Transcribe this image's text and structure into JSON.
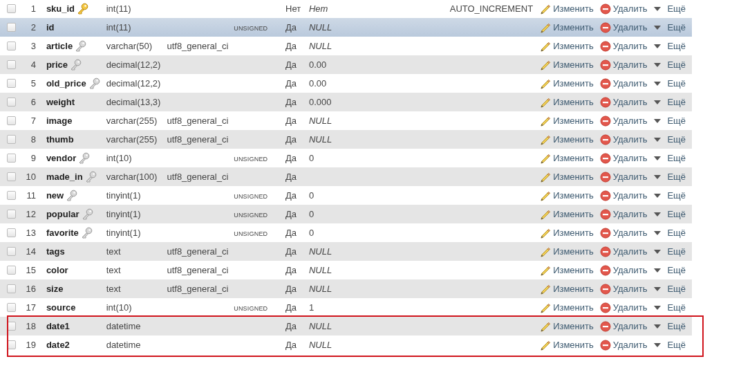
{
  "columns_table": {
    "rows": [
      {
        "checked": false,
        "hovered": false,
        "framed": false,
        "number": "1",
        "name": "sku_id",
        "key": {
          "kind": "primary"
        },
        "type": "int(11)",
        "null": "Нет",
        "default": "Нет",
        "default_italic": true,
        "extra": "AUTO_INCREMENT",
        "actions": [
          {
            "kind": "edit",
            "label": "Изменить"
          },
          {
            "kind": "drop",
            "label": "Удалить"
          },
          {
            "kind": "more",
            "label": "Ещё"
          }
        ]
      },
      {
        "checked": false,
        "hovered": true,
        "framed": false,
        "number": "2",
        "name": "id",
        "type": "int(11)",
        "attributes": "UNSIGNED",
        "null": "Да",
        "default": "NULL",
        "default_italic": true,
        "actions": [
          {
            "kind": "edit",
            "label": "Изменить"
          },
          {
            "kind": "drop",
            "label": "Удалить"
          },
          {
            "kind": "more",
            "label": "Ещё"
          }
        ]
      },
      {
        "checked": false,
        "hovered": false,
        "framed": false,
        "number": "3",
        "name": "article",
        "key": {
          "kind": "index"
        },
        "type": "varchar(50)",
        "collation": "utf8_general_ci",
        "null": "Да",
        "default": "NULL",
        "default_italic": true,
        "actions": [
          {
            "kind": "edit",
            "label": "Изменить"
          },
          {
            "kind": "drop",
            "label": "Удалить"
          },
          {
            "kind": "more",
            "label": "Ещё"
          }
        ]
      },
      {
        "checked": false,
        "hovered": false,
        "framed": false,
        "number": "4",
        "name": "price",
        "key": {
          "kind": "index"
        },
        "type": "decimal(12,2)",
        "null": "Да",
        "default": "0.00",
        "default_italic": false,
        "actions": [
          {
            "kind": "edit",
            "label": "Изменить"
          },
          {
            "kind": "drop",
            "label": "Удалить"
          },
          {
            "kind": "more",
            "label": "Ещё"
          }
        ]
      },
      {
        "checked": false,
        "hovered": false,
        "framed": false,
        "number": "5",
        "name": "old_price",
        "key": {
          "kind": "index"
        },
        "type": "decimal(12,2)",
        "null": "Да",
        "default": "0.00",
        "default_italic": false,
        "actions": [
          {
            "kind": "edit",
            "label": "Изменить"
          },
          {
            "kind": "drop",
            "label": "Удалить"
          },
          {
            "kind": "more",
            "label": "Ещё"
          }
        ]
      },
      {
        "checked": false,
        "hovered": false,
        "framed": false,
        "number": "6",
        "name": "weight",
        "type": "decimal(13,3)",
        "null": "Да",
        "default": "0.000",
        "default_italic": false,
        "actions": [
          {
            "kind": "edit",
            "label": "Изменить"
          },
          {
            "kind": "drop",
            "label": "Удалить"
          },
          {
            "kind": "more",
            "label": "Ещё"
          }
        ]
      },
      {
        "checked": false,
        "hovered": false,
        "framed": false,
        "number": "7",
        "name": "image",
        "type": "varchar(255)",
        "collation": "utf8_general_ci",
        "null": "Да",
        "default": "NULL",
        "default_italic": true,
        "actions": [
          {
            "kind": "edit",
            "label": "Изменить"
          },
          {
            "kind": "drop",
            "label": "Удалить"
          },
          {
            "kind": "more",
            "label": "Ещё"
          }
        ]
      },
      {
        "checked": false,
        "hovered": false,
        "framed": false,
        "number": "8",
        "name": "thumb",
        "type": "varchar(255)",
        "collation": "utf8_general_ci",
        "null": "Да",
        "default": "NULL",
        "default_italic": true,
        "actions": [
          {
            "kind": "edit",
            "label": "Изменить"
          },
          {
            "kind": "drop",
            "label": "Удалить"
          },
          {
            "kind": "more",
            "label": "Ещё"
          }
        ]
      },
      {
        "checked": false,
        "hovered": false,
        "framed": false,
        "number": "9",
        "name": "vendor",
        "key": {
          "kind": "index"
        },
        "type": "int(10)",
        "attributes": "UNSIGNED",
        "null": "Да",
        "default": "0",
        "default_italic": false,
        "actions": [
          {
            "kind": "edit",
            "label": "Изменить"
          },
          {
            "kind": "drop",
            "label": "Удалить"
          },
          {
            "kind": "more",
            "label": "Ещё"
          }
        ]
      },
      {
        "checked": false,
        "hovered": false,
        "framed": false,
        "number": "10",
        "name": "made_in",
        "key": {
          "kind": "index"
        },
        "type": "varchar(100)",
        "collation": "utf8_general_ci",
        "null": "Да",
        "actions": [
          {
            "kind": "edit",
            "label": "Изменить"
          },
          {
            "kind": "drop",
            "label": "Удалить"
          },
          {
            "kind": "more",
            "label": "Ещё"
          }
        ]
      },
      {
        "checked": false,
        "hovered": false,
        "framed": false,
        "number": "11",
        "name": "new",
        "key": {
          "kind": "index"
        },
        "type": "tinyint(1)",
        "attributes": "UNSIGNED",
        "null": "Да",
        "default": "0",
        "default_italic": false,
        "actions": [
          {
            "kind": "edit",
            "label": "Изменить"
          },
          {
            "kind": "drop",
            "label": "Удалить"
          },
          {
            "kind": "more",
            "label": "Ещё"
          }
        ]
      },
      {
        "checked": false,
        "hovered": false,
        "framed": false,
        "number": "12",
        "name": "popular",
        "key": {
          "kind": "index"
        },
        "type": "tinyint(1)",
        "attributes": "UNSIGNED",
        "null": "Да",
        "default": "0",
        "default_italic": false,
        "actions": [
          {
            "kind": "edit",
            "label": "Изменить"
          },
          {
            "kind": "drop",
            "label": "Удалить"
          },
          {
            "kind": "more",
            "label": "Ещё"
          }
        ]
      },
      {
        "checked": false,
        "hovered": false,
        "framed": false,
        "number": "13",
        "name": "favorite",
        "key": {
          "kind": "index"
        },
        "type": "tinyint(1)",
        "attributes": "UNSIGNED",
        "null": "Да",
        "default": "0",
        "default_italic": false,
        "actions": [
          {
            "kind": "edit",
            "label": "Изменить"
          },
          {
            "kind": "drop",
            "label": "Удалить"
          },
          {
            "kind": "more",
            "label": "Ещё"
          }
        ]
      },
      {
        "checked": false,
        "hovered": false,
        "framed": false,
        "number": "14",
        "name": "tags",
        "type": "text",
        "collation": "utf8_general_ci",
        "null": "Да",
        "default": "NULL",
        "default_italic": true,
        "actions": [
          {
            "kind": "edit",
            "label": "Изменить"
          },
          {
            "kind": "drop",
            "label": "Удалить"
          },
          {
            "kind": "more",
            "label": "Ещё"
          }
        ]
      },
      {
        "checked": false,
        "hovered": false,
        "framed": false,
        "number": "15",
        "name": "color",
        "type": "text",
        "collation": "utf8_general_ci",
        "null": "Да",
        "default": "NULL",
        "default_italic": true,
        "actions": [
          {
            "kind": "edit",
            "label": "Изменить"
          },
          {
            "kind": "drop",
            "label": "Удалить"
          },
          {
            "kind": "more",
            "label": "Ещё"
          }
        ]
      },
      {
        "checked": false,
        "hovered": false,
        "framed": false,
        "number": "16",
        "name": "size",
        "type": "text",
        "collation": "utf8_general_ci",
        "null": "Да",
        "default": "NULL",
        "default_italic": true,
        "actions": [
          {
            "kind": "edit",
            "label": "Изменить"
          },
          {
            "kind": "drop",
            "label": "Удалить"
          },
          {
            "kind": "more",
            "label": "Ещё"
          }
        ]
      },
      {
        "checked": false,
        "hovered": false,
        "framed": false,
        "number": "17",
        "name": "source",
        "type": "int(10)",
        "attributes": "UNSIGNED",
        "null": "Да",
        "default": "1",
        "default_italic": false,
        "actions": [
          {
            "kind": "edit",
            "label": "Изменить"
          },
          {
            "kind": "drop",
            "label": "Удалить"
          },
          {
            "kind": "more",
            "label": "Ещё"
          }
        ]
      },
      {
        "checked": false,
        "hovered": false,
        "framed": true,
        "number": "18",
        "name": "date1",
        "type": "datetime",
        "null": "Да",
        "default": "NULL",
        "default_italic": true,
        "actions": [
          {
            "kind": "edit",
            "label": "Изменить"
          },
          {
            "kind": "drop",
            "label": "Удалить"
          },
          {
            "kind": "more",
            "label": "Ещё"
          }
        ]
      },
      {
        "checked": false,
        "hovered": false,
        "framed": true,
        "number": "19",
        "name": "date2",
        "type": "datetime",
        "null": "Да",
        "default": "NULL",
        "default_italic": true,
        "actions": [
          {
            "kind": "edit",
            "label": "Изменить"
          },
          {
            "kind": "drop",
            "label": "Удалить"
          },
          {
            "kind": "more",
            "label": "Ещё"
          }
        ]
      }
    ]
  }
}
